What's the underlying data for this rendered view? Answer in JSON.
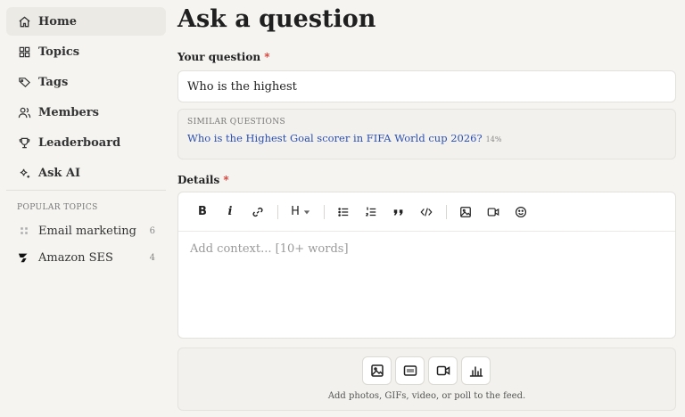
{
  "sidebar": {
    "nav": [
      {
        "label": "Home",
        "icon": "home-icon",
        "active": true
      },
      {
        "label": "Topics",
        "icon": "grid-icon"
      },
      {
        "label": "Tags",
        "icon": "tag-icon"
      },
      {
        "label": "Members",
        "icon": "users-icon"
      },
      {
        "label": "Leaderboard",
        "icon": "trophy-icon"
      },
      {
        "label": "Ask AI",
        "icon": "sparkle-icon"
      }
    ],
    "popular_label": "POPULAR TOPICS",
    "topics": [
      {
        "label": "Email marketing",
        "count": "6",
        "icon": "email-marketing-icon"
      },
      {
        "label": "Amazon SES",
        "count": "4",
        "icon": "amazon-ses-logo-icon"
      }
    ]
  },
  "main": {
    "title": "Ask a question",
    "question_label": "Your question",
    "required_mark": "*",
    "question_value": "Who is the highest",
    "similar": {
      "title": "SIMILAR QUESTIONS",
      "items": [
        {
          "text": "Who is the Highest Goal scorer in FIFA World cup 2026?",
          "match": "14%"
        }
      ]
    },
    "details_label": "Details",
    "toolbar": {
      "bold": "B",
      "italic": "i",
      "heading": "H"
    },
    "details_placeholder": "Add context... [10+ words]",
    "media_caption": "Add photos, GIFs, video, or poll to the feed."
  },
  "colors": {
    "background": "#f5f4f1",
    "accent_link": "#2a4fb4",
    "required": "#d9352b"
  }
}
